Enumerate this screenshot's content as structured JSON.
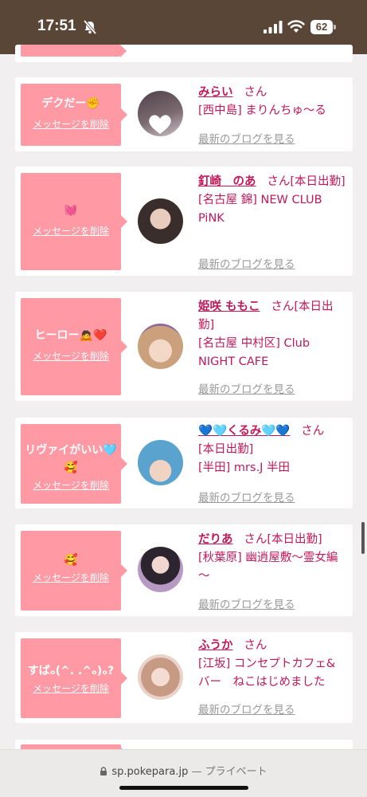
{
  "status": {
    "time": "17:51",
    "battery": "62"
  },
  "cards": [
    {
      "message": "デクだー✊",
      "delete": "メッセージを削除",
      "name": "みらい",
      "san": "さん",
      "shop": "[西中島] まりんちゅ～る",
      "blog": "最新のブログを見る",
      "avatar_bg": "#6d6066"
    },
    {
      "message": "💓",
      "delete": "メッセージを削除",
      "name": "釘崎　のあ",
      "san": "さん[本日出勤]",
      "shop": "[名古屋 錦] NEW CLUB PiNK",
      "blog": "最新のブログを見る",
      "avatar_bg": "#4a3c3a"
    },
    {
      "message": "ヒーロー🙇❤️",
      "delete": "メッセージを削除",
      "name": "姫咲 ももこ",
      "san": "さん[本日出勤]",
      "shop": "[名古屋 中村区] Club NIGHT CAFE",
      "blog": "最新のブログを見る",
      "avatar_bg": "#c7a07a"
    },
    {
      "message": "リヴァイがいい🩵🥰",
      "delete": "メッセージを削除",
      "name": "💙🩵くるみ🩵💙",
      "san": "さん",
      "day": "[本日出勤]",
      "shop": "[半田] mrs.J 半田",
      "blog": "最新のブログを見る",
      "avatar_bg": "#7fb6d6"
    },
    {
      "message": "🥰",
      "delete": "メッセージを削除",
      "name": "だりあ",
      "san": "さん[本日出勤]",
      "shop": "[秋葉原] 幽逍屋敷～霊女編～",
      "blog": "最新のブログを見る",
      "avatar_bg": "#8a6a8c"
    },
    {
      "message": "すばₒ(^. .^ₒ)ₒ?",
      "delete": "メッセージを削除",
      "name": "ふうか",
      "san": "さん",
      "shop": "[江坂] コンセプトカフェ&バー　ねこはじめました",
      "blog": "最新のブログを見る",
      "avatar_bg": "#d9b8ad"
    }
  ],
  "browser": {
    "url": "sp.pokepara.jp",
    "mode": "— プライベート"
  }
}
